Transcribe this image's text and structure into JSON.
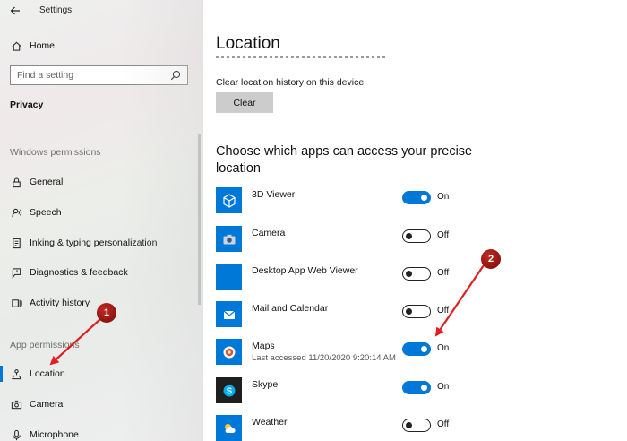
{
  "window": {
    "title": "Settings"
  },
  "sidebar": {
    "home_label": "Home",
    "search_placeholder": "Find a setting",
    "privacy_label": "Privacy",
    "windows_permissions_label": "Windows permissions",
    "windows_permissions_items": [
      {
        "label": "General",
        "icon": "lock-icon"
      },
      {
        "label": "Speech",
        "icon": "speech-icon"
      },
      {
        "label": "Inking & typing personalization",
        "icon": "inking-icon"
      },
      {
        "label": "Diagnostics & feedback",
        "icon": "diagnostics-icon"
      },
      {
        "label": "Activity history",
        "icon": "activity-history-icon"
      }
    ],
    "app_permissions_label": "App permissions",
    "app_permissions_items": [
      {
        "label": "Location",
        "icon": "location-icon",
        "selected": true
      },
      {
        "label": "Camera",
        "icon": "camera-icon"
      },
      {
        "label": "Microphone",
        "icon": "microphone-icon"
      }
    ]
  },
  "main": {
    "title": "Location",
    "clear_history_desc": "Clear location history on this device",
    "clear_button": "Clear",
    "apps_heading": "Choose which apps can access your precise location",
    "apps": [
      {
        "name": "3D Viewer",
        "sub": "",
        "state": "On",
        "on": true,
        "icon": "3d-viewer-icon"
      },
      {
        "name": "Camera",
        "sub": "",
        "state": "Off",
        "on": false,
        "icon": "camera-app-icon"
      },
      {
        "name": "Desktop App Web Viewer",
        "sub": "",
        "state": "Off",
        "on": false,
        "icon": "blank-tile-icon"
      },
      {
        "name": "Mail and Calendar",
        "sub": "",
        "state": "Off",
        "on": false,
        "icon": "mail-icon"
      },
      {
        "name": "Maps",
        "sub": "Last accessed 11/20/2020 9:20:14 AM",
        "state": "On",
        "on": true,
        "icon": "maps-icon"
      },
      {
        "name": "Skype",
        "sub": "",
        "state": "On",
        "on": true,
        "icon": "skype-icon"
      },
      {
        "name": "Weather",
        "sub": "",
        "state": "Off",
        "on": false,
        "icon": "weather-icon"
      }
    ]
  },
  "annotations": {
    "marker_1": "1",
    "marker_2": "2",
    "arrow_color": "#e01f1f"
  },
  "colors": {
    "accent": "#0078d7",
    "clear_button_bg": "#cccccc"
  }
}
